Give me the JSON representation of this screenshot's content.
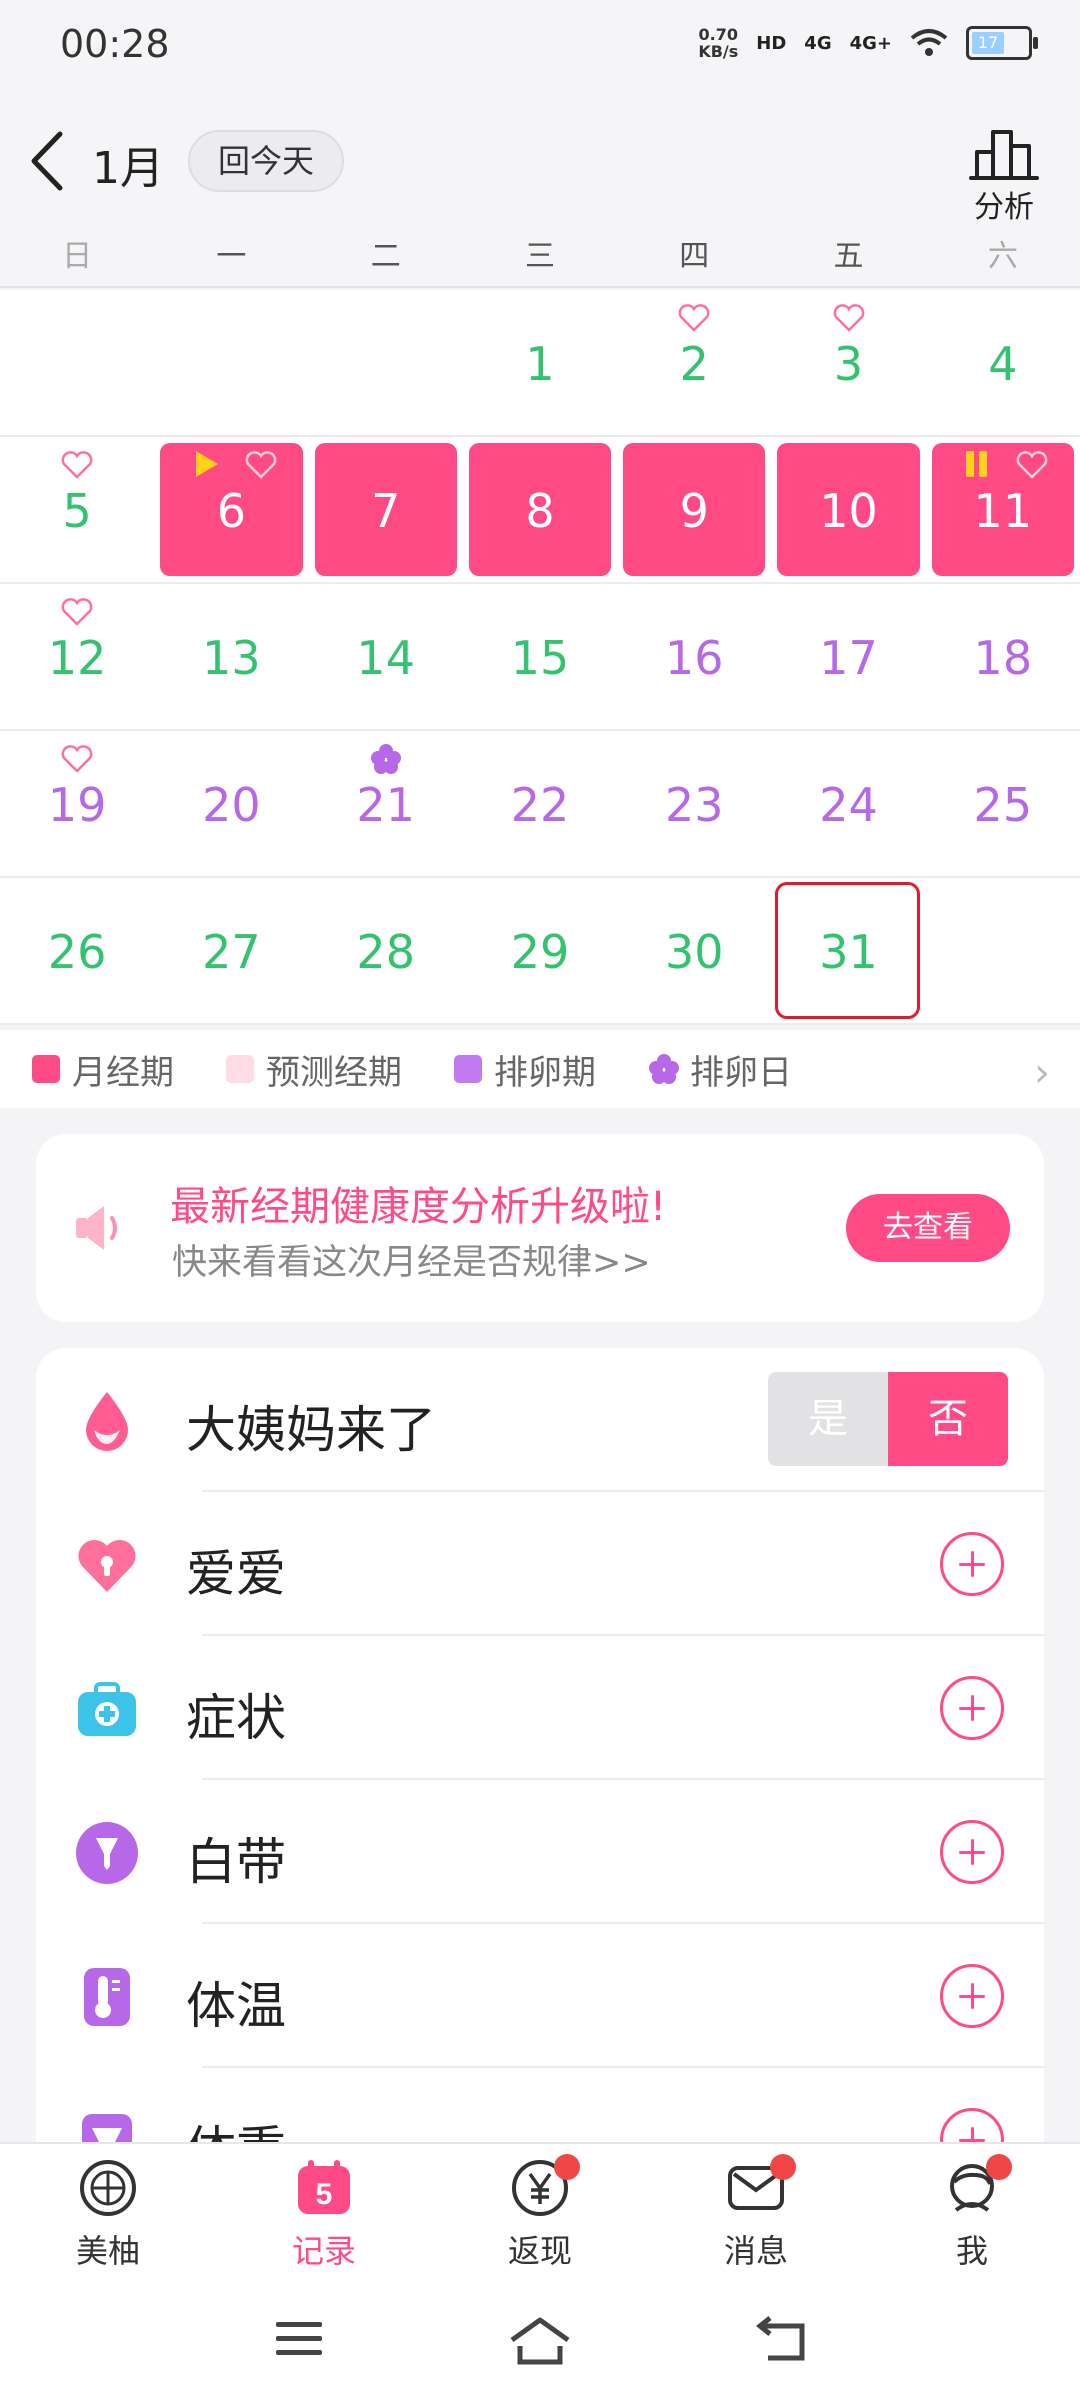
{
  "status_bar": {
    "time": "00:28",
    "net_speed_value": "0.70",
    "net_speed_unit": "KB/s",
    "hd_badge": "HD",
    "signal1": "4G",
    "signal2": "4G+",
    "battery_level": "17"
  },
  "header": {
    "month": "1月",
    "today_button": "回今天",
    "analysis_label": "分析"
  },
  "weekdays": [
    "日",
    "一",
    "二",
    "三",
    "四",
    "五",
    "六"
  ],
  "calendar": {
    "weeks": [
      [
        {
          "day": ""
        },
        {
          "day": ""
        },
        {
          "day": ""
        },
        {
          "day": "1",
          "color": "green"
        },
        {
          "day": "2",
          "color": "green",
          "heart": true
        },
        {
          "day": "3",
          "color": "green",
          "heart": true
        },
        {
          "day": "4",
          "color": "green"
        }
      ],
      [
        {
          "day": "5",
          "color": "green",
          "heart": true
        },
        {
          "day": "6",
          "color": "white",
          "period": true,
          "start_marker": true,
          "heart_right": true
        },
        {
          "day": "7",
          "color": "white",
          "period": true
        },
        {
          "day": "8",
          "color": "white",
          "period": true
        },
        {
          "day": "9",
          "color": "white",
          "period": true
        },
        {
          "day": "10",
          "color": "white",
          "period": true
        },
        {
          "day": "11",
          "color": "white",
          "period": true,
          "pause_marker": true,
          "heart_right": true
        }
      ],
      [
        {
          "day": "12",
          "color": "green",
          "heart": true
        },
        {
          "day": "13",
          "color": "green"
        },
        {
          "day": "14",
          "color": "green"
        },
        {
          "day": "15",
          "color": "green"
        },
        {
          "day": "16",
          "color": "purple"
        },
        {
          "day": "17",
          "color": "purple"
        },
        {
          "day": "18",
          "color": "purple"
        }
      ],
      [
        {
          "day": "19",
          "color": "purple",
          "heart": true
        },
        {
          "day": "20",
          "color": "purple"
        },
        {
          "day": "21",
          "color": "purple",
          "flower": true
        },
        {
          "day": "22",
          "color": "purple"
        },
        {
          "day": "23",
          "color": "purple"
        },
        {
          "day": "24",
          "color": "purple"
        },
        {
          "day": "25",
          "color": "purple"
        }
      ],
      [
        {
          "day": "26",
          "color": "green"
        },
        {
          "day": "27",
          "color": "green"
        },
        {
          "day": "28",
          "color": "green"
        },
        {
          "day": "29",
          "color": "green"
        },
        {
          "day": "30",
          "color": "green"
        },
        {
          "day": "31",
          "color": "green",
          "today": true
        },
        {
          "day": ""
        }
      ]
    ]
  },
  "legend": {
    "items": [
      {
        "label": "月经期",
        "color": "#ff4a86"
      },
      {
        "label": "预测经期",
        "color": "#ffdbe6"
      },
      {
        "label": "排卵期",
        "color": "#c17af0"
      },
      {
        "label": "排卵日",
        "color": "#b668e8"
      }
    ]
  },
  "banner": {
    "title": "最新经期健康度分析升级啦!",
    "subtitle": "快来看看这次月经是否规律>>",
    "button": "去查看"
  },
  "records": {
    "period_label": "大姨妈来了",
    "toggle_yes": "是",
    "toggle_no": "否",
    "items": [
      {
        "label": "爱爱",
        "icon": "heart-lock-icon"
      },
      {
        "label": "症状",
        "icon": "medical-kit-icon"
      },
      {
        "label": "白带",
        "icon": "discharge-icon"
      },
      {
        "label": "体温",
        "icon": "thermometer-icon"
      },
      {
        "label": "体重",
        "icon": "weight-scale-icon"
      }
    ]
  },
  "tabs": [
    {
      "label": "美柚",
      "icon": "meiyou-icon"
    },
    {
      "label": "记录",
      "icon": "calendar-record-icon",
      "badge": "5"
    },
    {
      "label": "返现",
      "icon": "cashback-icon"
    },
    {
      "label": "消息",
      "icon": "message-icon"
    },
    {
      "label": "我",
      "icon": "profile-icon"
    }
  ],
  "colors": {
    "accent": "#ff4a86",
    "green": "#33c26e",
    "purple": "#b668e8",
    "today_border": "#e01c2c"
  }
}
